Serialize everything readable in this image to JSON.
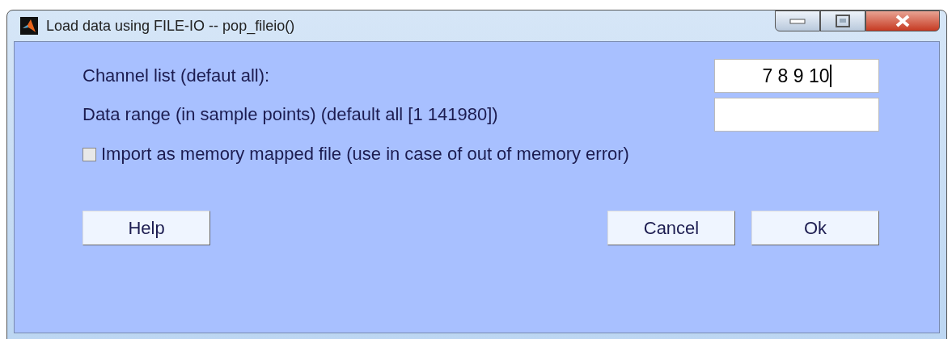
{
  "window": {
    "title": "Load data using FILE-IO -- pop_fileio()"
  },
  "fields": [
    {
      "label": "Channel list (defaut all):",
      "value": "7 8 9 10"
    },
    {
      "label": "Data range (in sample points) (default all [1 141980])"
    }
  ],
  "checkbox": {
    "label": "Import as memory mapped file (use in case of out of memory error)",
    "checked": false
  },
  "buttons": {
    "left": [
      "Help"
    ],
    "right": [
      "Cancel",
      "Ok"
    ]
  }
}
